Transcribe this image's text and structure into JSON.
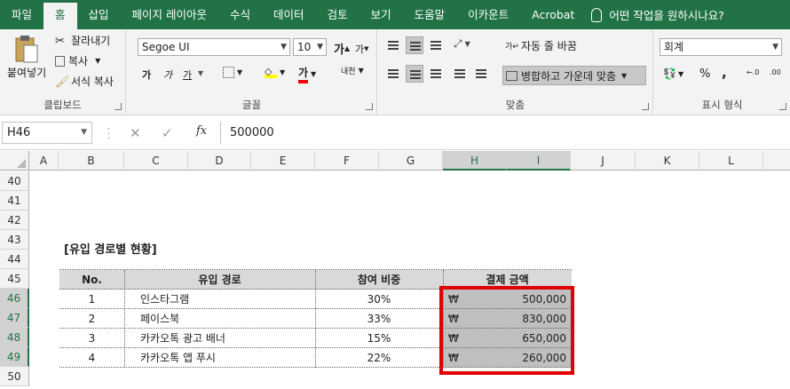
{
  "tabs": [
    "파일",
    "홈",
    "삽입",
    "페이지 레이아웃",
    "수식",
    "데이터",
    "검토",
    "보기",
    "도움말",
    "이카운트",
    "Acrobat"
  ],
  "active_tab": "홈",
  "tell_me": "어떤 작업을 원하시나요?",
  "ribbon": {
    "clipboard": {
      "paste": "붙여넣기",
      "cut": "잘라내기",
      "copy": "복사",
      "format_painter": "서식 복사",
      "label": "클립보드"
    },
    "font": {
      "name": "Segoe UI",
      "size": "10",
      "grow": "가",
      "shrink": "가",
      "bold": "가",
      "italic": "가",
      "underline": "가",
      "color_glyph": "가",
      "phonetic": "내천",
      "label": "글꼴"
    },
    "alignment": {
      "wrap": "자동 줄 바꿈",
      "merge": "병합하고 가운데 맞춤",
      "label": "맞춤"
    },
    "number": {
      "format": "회계",
      "percent": "%",
      "comma": ",",
      "label": "표시 형식"
    }
  },
  "formula_bar": {
    "name_box": "H46",
    "value": "500000",
    "fx": "fx",
    "cancel": "✕",
    "enter": "✓"
  },
  "columns": [
    "A",
    "B",
    "C",
    "D",
    "E",
    "F",
    "G",
    "H",
    "I",
    "J",
    "K",
    "L"
  ],
  "rows": [
    "40",
    "41",
    "42",
    "43",
    "44",
    "45",
    "46",
    "47",
    "48",
    "49",
    "50"
  ],
  "sheet": {
    "title": "[유입 경로별 현황]",
    "headers": {
      "no": "No.",
      "path": "유입 경로",
      "share": "참여 비중",
      "amount": "결제 금액"
    },
    "records": [
      {
        "no": "1",
        "path": "인스타그램",
        "share": "30%",
        "currency": "₩",
        "amount": "500,000"
      },
      {
        "no": "2",
        "path": "페이스북",
        "share": "33%",
        "currency": "₩",
        "amount": "830,000"
      },
      {
        "no": "3",
        "path": "카카오톡 광고 배너",
        "share": "15%",
        "currency": "₩",
        "amount": "650,000"
      },
      {
        "no": "4",
        "path": "카카오톡 앱 푸시",
        "share": "22%",
        "currency": "₩",
        "amount": "260,000"
      }
    ]
  },
  "colors": {
    "excel_green": "#217346",
    "highlight_red": "#e00000",
    "header_fill": "#d9d9d9",
    "selection_fill": "#bfbfbf"
  }
}
